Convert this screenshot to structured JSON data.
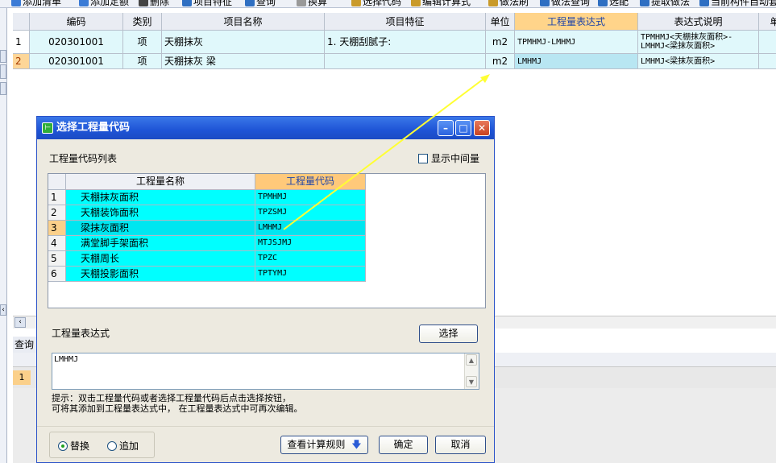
{
  "toolbar": {
    "items": [
      {
        "label": "添加清单",
        "icon": "add-list-icon",
        "color": "#3b7bd6"
      },
      {
        "label": "添加定额",
        "icon": "add-quota-icon",
        "color": "#3b7bd6"
      },
      {
        "label": "删除",
        "icon": "delete-icon",
        "color": "#444444"
      },
      {
        "label": "项目特征",
        "icon": "project-feature-icon",
        "color": "#2f6fc2"
      },
      {
        "label": "查询",
        "icon": "search-icon",
        "color": "#2f6fc2"
      },
      {
        "label": "换算",
        "icon": "convert-icon",
        "color": "#999999"
      },
      {
        "label": "选择代码",
        "icon": "select-code-icon",
        "color": "#c99a2a"
      },
      {
        "label": "编辑计算式",
        "icon": "edit-formula-icon",
        "color": "#c99a2a"
      },
      {
        "label": "做法刷",
        "icon": "brush-icon",
        "color": "#c99a2a"
      },
      {
        "label": "做法查询",
        "icon": "method-query-icon",
        "color": "#2f6fc2"
      },
      {
        "label": "选配",
        "icon": "match-icon",
        "color": "#2f6fc2"
      },
      {
        "label": "提取做法",
        "icon": "extract-icon",
        "color": "#2f6fc2"
      },
      {
        "label": "当前构件自动套",
        "icon": "auto-apply-icon",
        "color": "#2f6fc2"
      }
    ]
  },
  "main_grid": {
    "headers": [
      "编码",
      "类别",
      "项目名称",
      "项目特征",
      "单位",
      "工程量表达式",
      "表达式说明",
      "单"
    ],
    "rows": [
      {
        "num": "1",
        "code": "020301001",
        "type": "项",
        "name": "天棚抹灰",
        "feature": "1. 天棚刮腻子:",
        "unit": "m2",
        "expr": "TPMHMJ-LMHMJ",
        "desc1": "TPMHMJ<天棚抹灰面积>-",
        "desc2": "LMHMJ<梁抹灰面积>"
      },
      {
        "num": "2",
        "code": "020301001",
        "type": "项",
        "name": "天棚抹灰 梁",
        "feature": "",
        "unit": "m2",
        "expr": "LMHMJ",
        "desc1": "LMHMJ<梁抹灰面积>",
        "desc2": ""
      }
    ]
  },
  "bottom_panel": {
    "query_label": "查询",
    "row_num": "1"
  },
  "dialog": {
    "title": "选择工程量代码",
    "list_label": "工程量代码列表",
    "show_intermediate_label": "显示中间量",
    "show_intermediate_checked": false,
    "grid_headers": [
      "工程量名称",
      "工程量代码"
    ],
    "rows": [
      {
        "num": "1",
        "name": "天棚抹灰面积",
        "code": "TPMHMJ"
      },
      {
        "num": "2",
        "name": "天棚装饰面积",
        "code": "TPZSMJ"
      },
      {
        "num": "3",
        "name": "梁抹灰面积",
        "code": "LMHMJ"
      },
      {
        "num": "4",
        "name": "满堂脚手架面积",
        "code": "MTJSJMJ"
      },
      {
        "num": "5",
        "name": "天棚周长",
        "code": "TPZC"
      },
      {
        "num": "6",
        "name": "天棚投影面积",
        "code": "TPTYMJ"
      }
    ],
    "selected_row": 3,
    "expr_label": "工程量表达式",
    "select_button": "选择",
    "expr_value": "LMHMJ",
    "hint_line1": "提示：双击工程量代码或者选择工程量代码后点击选择按钮，",
    "hint_line2": "可将其添加到工程量表达式中， 在工程量表达式中可再次编辑。",
    "radio_replace": "替换",
    "radio_append": "追加",
    "radio_selected": "replace",
    "view_rules_button": "查看计算规则",
    "ok_button": "确定",
    "cancel_button": "取消"
  },
  "colors": {
    "dialog_title_bar": "#1e54d6",
    "highlight_header": "#ffc97a",
    "cyan_rows": "#00ffff",
    "annotation_arrow": "#ffff33"
  }
}
